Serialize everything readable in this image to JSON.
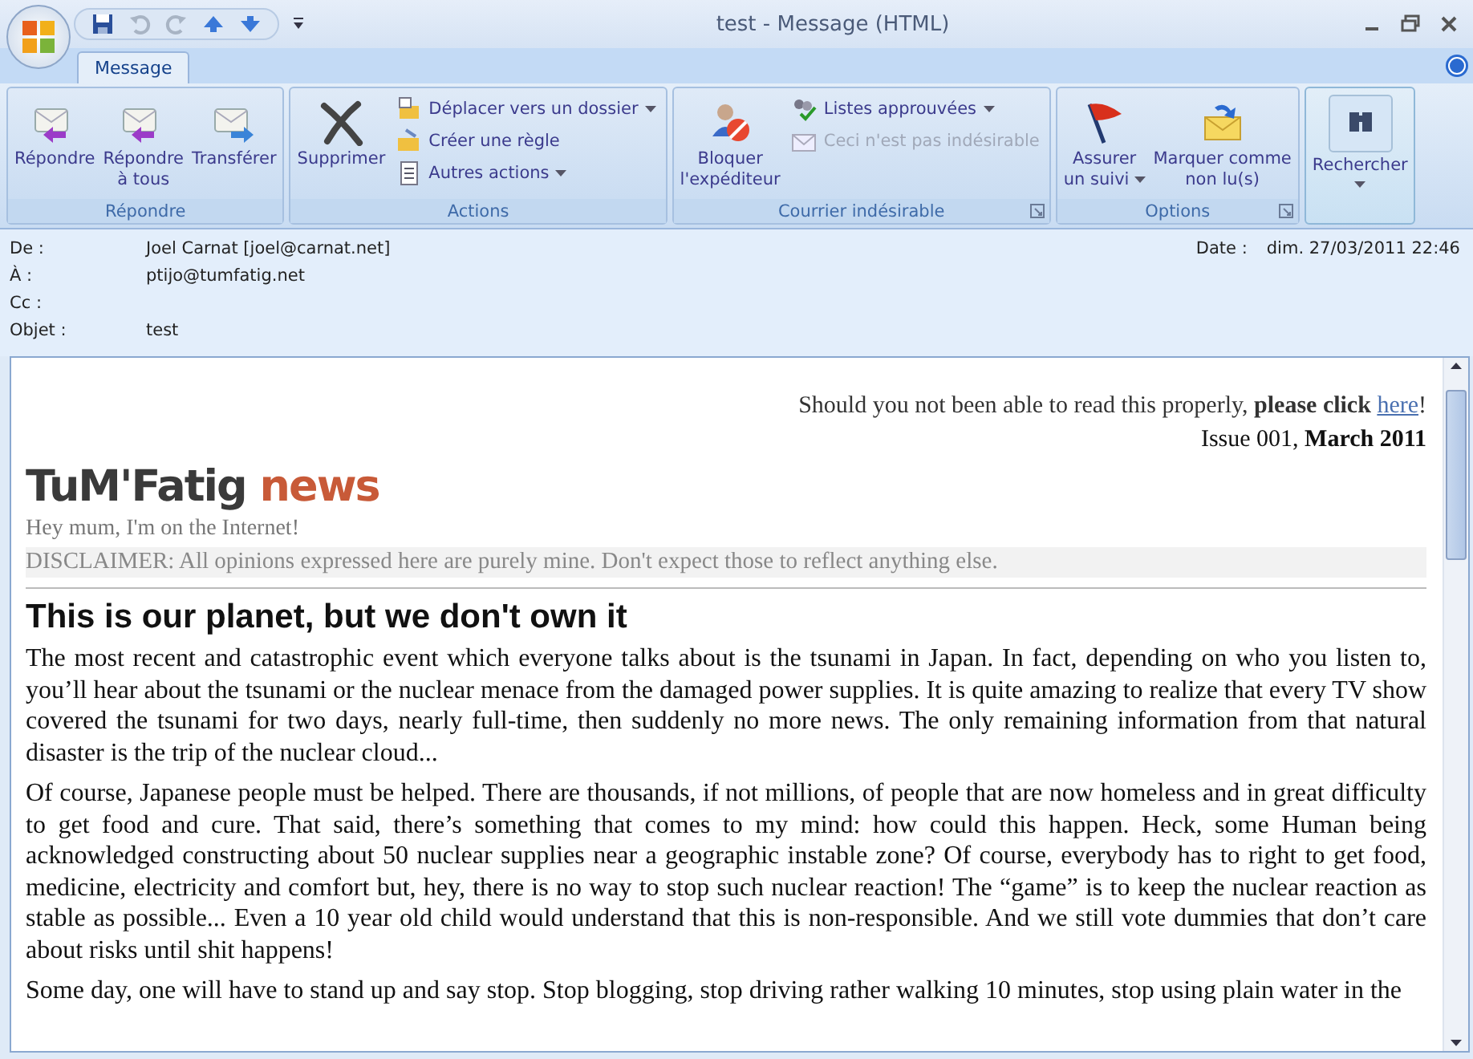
{
  "window": {
    "title": "test - Message (HTML)"
  },
  "tabs": [
    {
      "label": "Message",
      "selected": true
    }
  ],
  "ribbon_groups": [
    {
      "label": "Répondre",
      "launcher": false,
      "items": [
        {
          "kind": "large",
          "lines": [
            "Répondre"
          ],
          "dropdown": false,
          "disabled": false
        },
        {
          "kind": "large",
          "lines": [
            "Répondre",
            "à tous"
          ],
          "dropdown": false,
          "disabled": false
        },
        {
          "kind": "large",
          "lines": [
            "Transférer"
          ],
          "dropdown": false,
          "disabled": false
        }
      ]
    },
    {
      "label": "Actions",
      "launcher": false,
      "items": [
        {
          "kind": "large",
          "lines": [
            "Supprimer"
          ],
          "dropdown": false,
          "disabled": false
        },
        {
          "kind": "small",
          "lines": [
            "Déplacer vers un dossier"
          ],
          "dropdown": true,
          "disabled": false
        },
        {
          "kind": "small",
          "lines": [
            "Créer une règle"
          ],
          "dropdown": false,
          "disabled": false
        },
        {
          "kind": "small",
          "lines": [
            "Autres actions"
          ],
          "dropdown": true,
          "disabled": false
        }
      ]
    },
    {
      "label": "Courrier indésirable",
      "launcher": true,
      "items": [
        {
          "kind": "large",
          "lines": [
            "Bloquer",
            "l'expéditeur"
          ],
          "dropdown": false,
          "disabled": false
        },
        {
          "kind": "small",
          "lines": [
            "Listes approuvées"
          ],
          "dropdown": true,
          "disabled": false
        },
        {
          "kind": "small",
          "lines": [
            "Ceci n'est pas indésirable"
          ],
          "dropdown": false,
          "disabled": true
        }
      ]
    },
    {
      "label": "Options",
      "launcher": true,
      "items": [
        {
          "kind": "large",
          "lines": [
            "Assurer",
            "un suivi"
          ],
          "dropdown": true,
          "disabled": false
        },
        {
          "kind": "large",
          "lines": [
            "Marquer comme",
            "non lu(s)"
          ],
          "dropdown": false,
          "disabled": false
        }
      ]
    },
    {
      "items": [
        {
          "kind": "search",
          "lines": [
            "Rechercher"
          ],
          "dropdown": true,
          "disabled": false
        }
      ]
    }
  ],
  "headers": [
    {
      "label": "De :",
      "value": "Joel Carnat [joel@carnat.net]"
    },
    {
      "label": "À :",
      "value": "ptijo@tumfatig.net"
    },
    {
      "label": "Cc :"
    },
    {
      "label": "Objet :",
      "value": "test"
    }
  ],
  "date": {
    "label": "Date :",
    "value": "dim. 27/03/2011 22:46"
  },
  "message": {
    "notice": {
      "before": "Should you not been able to read this properly, **please click** ",
      "link": "here",
      "after": "!"
    },
    "issue": "Issue 001, **March 2011**",
    "logo": {
      "name": "TuM'Fatig",
      "accent": "news"
    },
    "tagline": "Hey mum, I'm on the Internet!",
    "disclaimer": "DISCLAIMER: All opinions expressed here are purely mine. Don't expect those to reflect anything else.",
    "heading": "This is our planet, but we don't own it",
    "paragraphs": [
      "The most recent and catastrophic event which everyone talks about is the tsunami in Japan. In fact, depending on who you listen to, you’ll hear about the tsunami or the nuclear menace from the damaged power supplies. It is quite amazing to realize that every TV show covered the tsunami for two days, nearly full-time, then suddenly no more news. The only remaining information from that natural disaster is the trip of the nuclear cloud...",
      "Of course, Japanese people must be helped. There are thousands, if not millions, of people that are now homeless and in great difficulty to get food and cure. That said, there’s something that comes to my mind: how could this happen. Heck, some Human being acknowledged constructing about 50 nuclear supplies near a geographic instable zone? Of course, everybody has to right to get food, medicine, electricity and comfort but, hey, there is no way to stop such nuclear reaction! The “game” is to keep the nuclear reaction as stable as possible... Even a 10 year old child would understand that this is non-responsible. And we still vote dummies that don’t care about risks until shit happens!",
      "Some day, one will have to stand up and say stop. Stop blogging, stop driving rather walking 10 minutes, stop using plain water in the"
    ]
  }
}
